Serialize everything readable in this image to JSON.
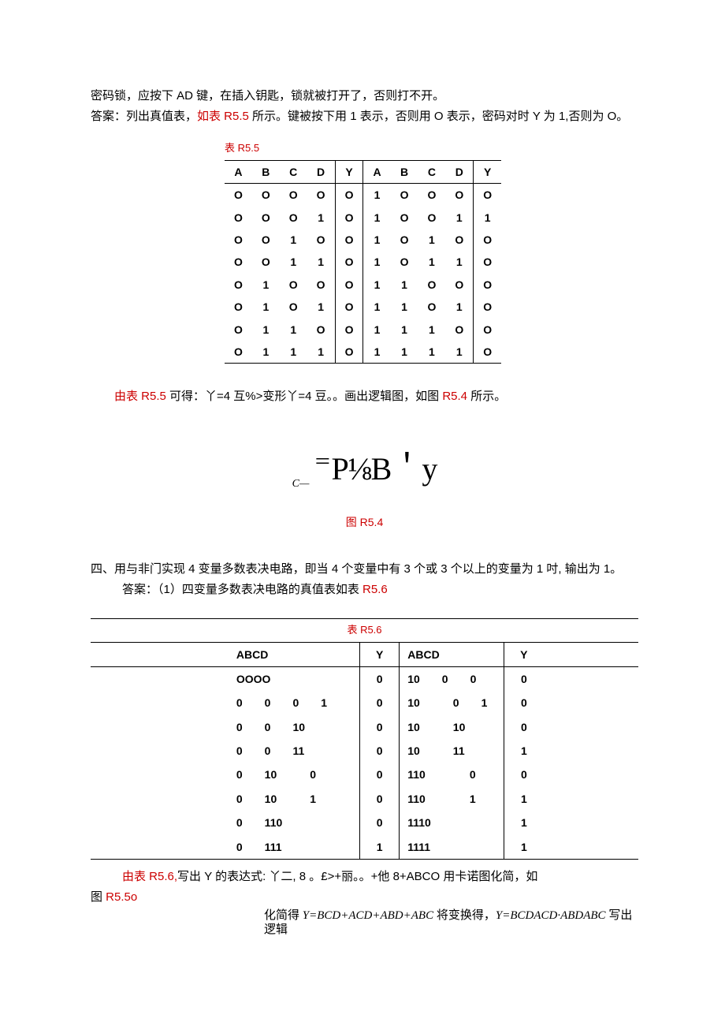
{
  "intro": {
    "line1": "密码锁，应按下 AD 键，在插入钥匙，锁就被打开了，否则打不开。",
    "line2a": "答案：列出真值表，",
    "line2b": "如表 R5.5",
    "line2c": " 所示。键被按下用 1 表示，否则用 O 表示，密码对时 Y 为 1,否则为 O。"
  },
  "table55": {
    "title": "表 R5.5",
    "head": [
      "A",
      "B",
      "C",
      "D",
      "Y",
      "A",
      "B",
      "C",
      "D",
      "Y"
    ],
    "rows": [
      [
        "O",
        "O",
        "O",
        "O",
        "O",
        "1",
        "O",
        "O",
        "O",
        "O"
      ],
      [
        "O",
        "O",
        "O",
        "1",
        "O",
        "1",
        "O",
        "O",
        "1",
        "1"
      ],
      [
        "O",
        "O",
        "1",
        "O",
        "O",
        "1",
        "O",
        "1",
        "O",
        "O"
      ],
      [
        "O",
        "O",
        "1",
        "1",
        "O",
        "1",
        "O",
        "1",
        "1",
        "O"
      ],
      [
        "O",
        "1",
        "O",
        "O",
        "O",
        "1",
        "1",
        "O",
        "O",
        "O"
      ],
      [
        "O",
        "1",
        "O",
        "1",
        "O",
        "1",
        "1",
        "O",
        "1",
        "O"
      ],
      [
        "O",
        "1",
        "1",
        "O",
        "O",
        "1",
        "1",
        "1",
        "O",
        "O"
      ],
      [
        "O",
        "1",
        "1",
        "1",
        "O",
        "1",
        "1",
        "1",
        "1",
        "O"
      ]
    ]
  },
  "derive": {
    "prefix": "由表 R5.5",
    "rest": " 可得：丫=4 互%>变形丫=4 豆。。画出逻辑图，如图 ",
    "ref": "R5.4",
    "tail": " 所示。"
  },
  "figure": {
    "c": "C—",
    "eq": "＝",
    "body": "P⅛B＇y",
    "caption": "图 R5.4"
  },
  "sec4": {
    "q": "四、用与非门实现 4 变量多数表决电路，即当 4 个变量中有 3 个或 3 个以上的变量为 1 吋, 输出为 1。",
    "a_prefix": "答案：（1）四变量多数表决电路的真值表如表 ",
    "a_ref": "R5.6"
  },
  "table56": {
    "title": "表 R5.6",
    "head_left": "ABCD",
    "head_y": "Y",
    "head_right": "ABCD",
    "rows": [
      {
        "l": "OOOO",
        "y1": "0",
        "r": "10　　0　　0",
        "y2": "0"
      },
      {
        "l": "0　　0　　0　　1",
        "y1": "0",
        "r": "10　　　0　　1",
        "y2": "0"
      },
      {
        "l": "0　　0　　10",
        "y1": "0",
        "r": "10　　　10",
        "y2": "0"
      },
      {
        "l": "0　　0　　11",
        "y1": "0",
        "r": "10　　　11",
        "y2": "1"
      },
      {
        "l": "0　　10　　　0",
        "y1": "0",
        "r": "110　　　　0",
        "y2": "0"
      },
      {
        "l": "0　　10　　　1",
        "y1": "0",
        "r": "110　　　　1",
        "y2": "1"
      },
      {
        "l": "0　　110",
        "y1": "0",
        "r": "1110",
        "y2": "1"
      },
      {
        "l": "0　　111",
        "y1": "1",
        "r": "1111",
        "y2": "1"
      }
    ]
  },
  "post56": {
    "p1_prefix": "由表 R5.6,",
    "p1_mid": "写出 Y 的表达式: 丫二, 8 。£>+丽。。+他 8+ABCO 用卡诺图化简，如",
    "p2_prefix": "图 ",
    "p2_ref": "R5.5o",
    "final1a": "化简得 ",
    "final1b": "Y=BCD+ACD+ABD+ABC",
    "final1c": " 将变换得，",
    "final1d": "Y=BCDACD·ABDABC",
    "final1e": " 写出逻辑"
  }
}
